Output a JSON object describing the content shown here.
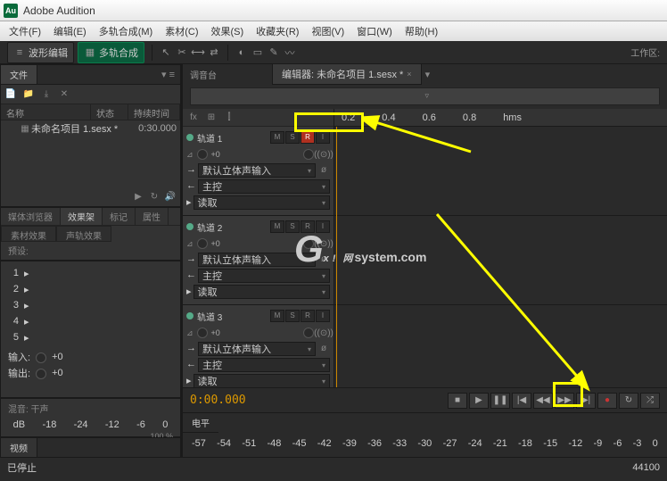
{
  "app": {
    "title": "Adobe Audition",
    "icon": "Au"
  },
  "menu": [
    "文件(F)",
    "编辑(E)",
    "多轨合成(M)",
    "素材(C)",
    "效果(S)",
    "收藏夹(R)",
    "视图(V)",
    "窗口(W)",
    "帮助(H)"
  ],
  "toolbar": {
    "wave": "波形编辑",
    "multitrack": "多轨合成",
    "workspace": "工作区:"
  },
  "filesPanel": {
    "tab": "文件",
    "cols": {
      "name": "名称",
      "status": "状态",
      "duration": "持续时间"
    },
    "items": [
      {
        "name": "未命名项目 1.sesx *",
        "duration": "0:30.000"
      }
    ]
  },
  "mediaPanel": {
    "tabs": [
      "媒体浏览器",
      "效果架",
      "标记",
      "属性"
    ],
    "active": 1,
    "subtabs": [
      "素材效果",
      "声轨效果"
    ],
    "presetLabel": "预设:"
  },
  "sends": {
    "rows": [
      "1",
      "2",
      "3",
      "4",
      "5"
    ],
    "input": "输入: ",
    "output": "输出: ",
    "inVal": "+0",
    "outVal": "+0"
  },
  "mixPanel": {
    "label": "混音: 干声",
    "dbTicks": [
      "dB",
      "-18",
      "-24",
      "-12",
      "-6",
      "0"
    ],
    "pct": "100 %"
  },
  "videoPanel": {
    "tab": "视频"
  },
  "editor": {
    "groupLabel": "编辑器:",
    "tab": "编辑器: 未命名项目 1.sesx *",
    "mixerLabel": "调音台"
  },
  "ruler": {
    "ticks": [
      "0.2",
      "0.4",
      "0.6",
      "0.8",
      "hms",
      "",
      "",
      "",
      ""
    ],
    "time": "0:00.000"
  },
  "tracks": [
    {
      "name": "轨道 1",
      "armed": true,
      "vol": "+0",
      "input": "默认立体声输入",
      "bus": "主控",
      "read": "读取"
    },
    {
      "name": "轨道 2",
      "armed": false,
      "vol": "+0",
      "input": "默认立体声输入",
      "bus": "主控",
      "read": "读取"
    },
    {
      "name": "轨道 3",
      "armed": false,
      "vol": "+0",
      "input": "默认立体声输入",
      "bus": "主控",
      "read": "读取"
    }
  ],
  "msri": [
    "M",
    "S",
    "R",
    "I"
  ],
  "transport": {
    "time": "0:00.000"
  },
  "levels": {
    "tab": "电平",
    "ticks": [
      "-57",
      "-54",
      "-51",
      "-48",
      "-45",
      "-42",
      "-39",
      "-36",
      "-33",
      "-30",
      "-27",
      "-24",
      "-21",
      "-18",
      "-15",
      "-12",
      "-9",
      "-6",
      "-3",
      "0"
    ]
  },
  "status": {
    "left": "已停止",
    "sr": "44100"
  }
}
